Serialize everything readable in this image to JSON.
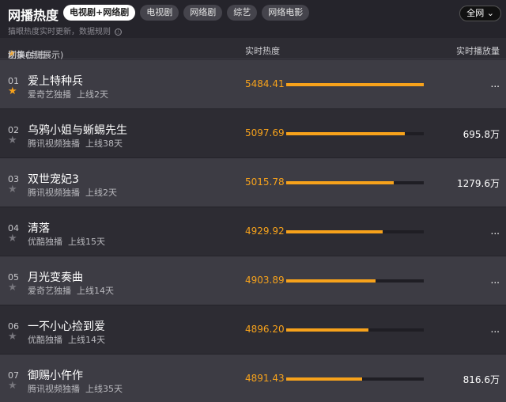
{
  "header": {
    "title": "网播热度",
    "tabs": [
      {
        "label": "电视剧+网络剧",
        "active": true
      },
      {
        "label": "电视剧",
        "active": false
      },
      {
        "label": "网络剧",
        "active": false
      },
      {
        "label": "综艺",
        "active": false
      },
      {
        "label": "网络电影",
        "active": false
      }
    ],
    "scope_label": "全网",
    "scope_icon": "chevron-down-icon",
    "subtitle": "猫眼热度实时更新，数据规则",
    "info_icon": "ⓘ"
  },
  "columns": {
    "show_prefix": "剧集(点击",
    "show_suffix": "切换右侧展示)",
    "heat": "实时热度",
    "plays": "实时播放量"
  },
  "rows": [
    {
      "rank": "01",
      "name": "爱上特种兵",
      "platform": "爱奇艺独播",
      "online": "上线2天",
      "heat": "5484.41",
      "level": 1.0,
      "plays": "...",
      "starred": true,
      "highlight": true
    },
    {
      "rank": "02",
      "name": "乌鸦小姐与蜥蜴先生",
      "platform": "腾讯视频独播",
      "online": "上线38天",
      "heat": "5097.69",
      "level": 0.86,
      "plays": "695.8万",
      "starred": false,
      "highlight": false
    },
    {
      "rank": "03",
      "name": "双世宠妃3",
      "platform": "腾讯视频独播",
      "online": "上线2天",
      "heat": "5015.78",
      "level": 0.78,
      "plays": "1279.6万",
      "starred": false,
      "highlight": true
    },
    {
      "rank": "04",
      "name": "清落",
      "platform": "优酷独播",
      "online": "上线15天",
      "heat": "4929.92",
      "level": 0.7,
      "plays": "...",
      "starred": false,
      "highlight": false
    },
    {
      "rank": "05",
      "name": "月光变奏曲",
      "platform": "爱奇艺独播",
      "online": "上线14天",
      "heat": "4903.89",
      "level": 0.65,
      "plays": "...",
      "starred": false,
      "highlight": true
    },
    {
      "rank": "06",
      "name": "一不小心捡到爱",
      "platform": "优酷独播",
      "online": "上线14天",
      "heat": "4896.20",
      "level": 0.6,
      "plays": "...",
      "starred": false,
      "highlight": false
    },
    {
      "rank": "07",
      "name": "御赐小仵作",
      "platform": "腾讯视频独播",
      "online": "上线35天",
      "heat": "4891.43",
      "level": 0.55,
      "plays": "816.6万",
      "starred": false,
      "highlight": true
    }
  ],
  "colors": {
    "accent": "#f7a21b",
    "background": "#2d2c33",
    "row_highlight": "#3d3c44"
  }
}
